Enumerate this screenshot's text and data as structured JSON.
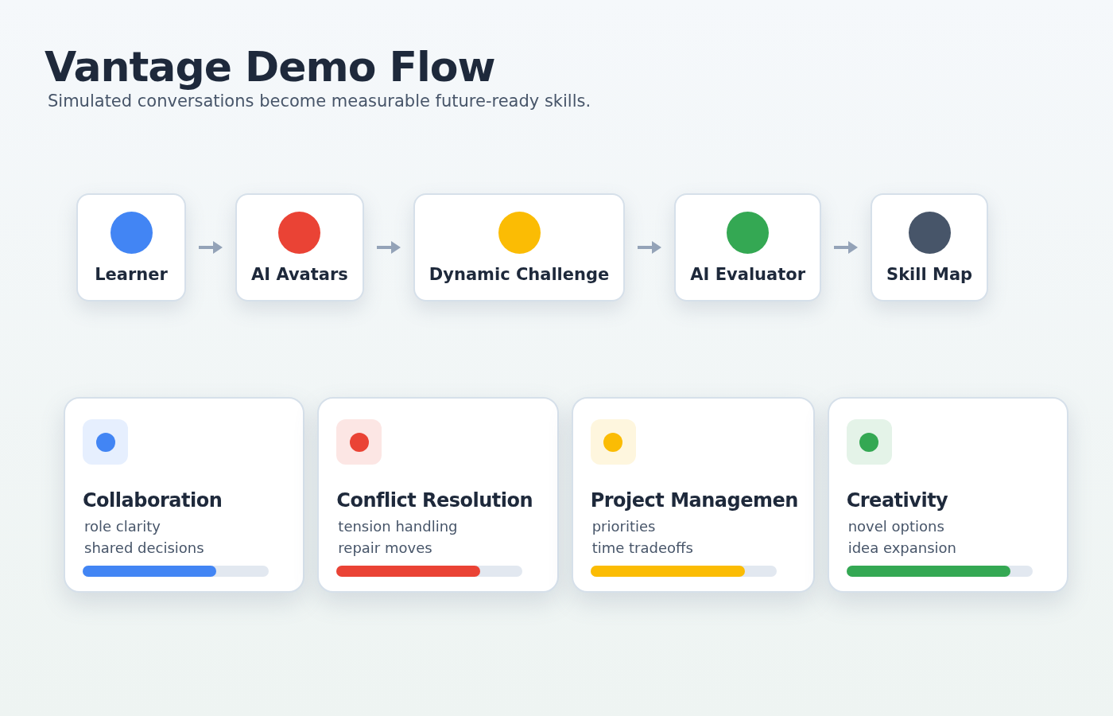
{
  "header": {
    "title": "Vantage Demo Flow",
    "subtitle": "Simulated conversations become measurable future-ready skills."
  },
  "flow": [
    {
      "label": "Learner",
      "color": "#4285f4"
    },
    {
      "label": "AI Avatars",
      "color": "#ea4335"
    },
    {
      "label": "Dynamic Challenge",
      "color": "#fbbc04"
    },
    {
      "label": "AI Evaluator",
      "color": "#34a853"
    },
    {
      "label": "Skill Map",
      "color": "#475569"
    }
  ],
  "skills": [
    {
      "title": "Collaboration",
      "lines": [
        "role clarity",
        "shared decisions"
      ],
      "color": "#4285f4",
      "level": 0.72
    },
    {
      "title": "Conflict Resolution",
      "lines": [
        "tension handling",
        "repair moves"
      ],
      "color": "#ea4335",
      "level": 0.77
    },
    {
      "title": "Project Managemen",
      "lines": [
        "priorities",
        "time tradeoffs"
      ],
      "color": "#fbbc04",
      "level": 0.83
    },
    {
      "title": "Creativity",
      "lines": [
        "novel options",
        "idea expansion"
      ],
      "color": "#34a853",
      "level": 0.88
    }
  ]
}
